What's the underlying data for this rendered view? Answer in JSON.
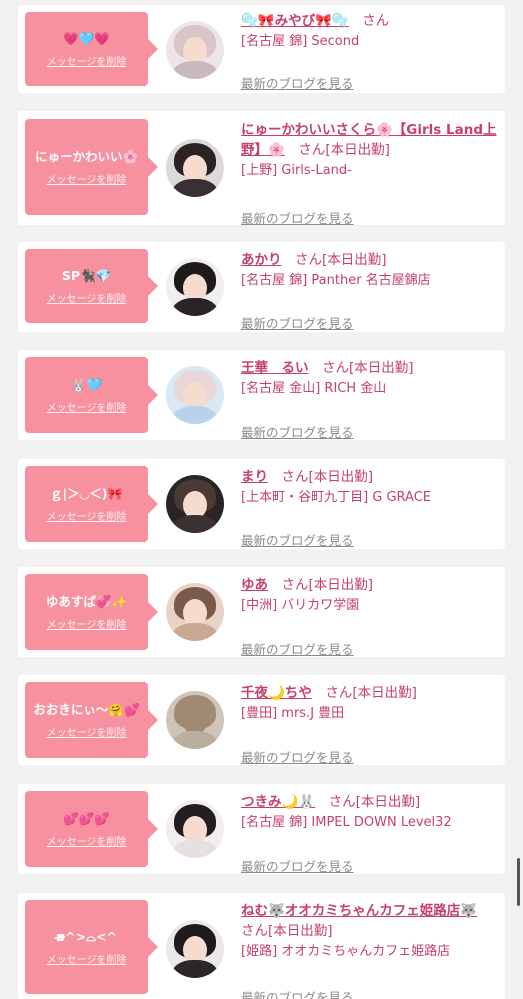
{
  "cards": [
    {
      "message": "💗🩵💗",
      "delete_label": "メッセージを削除",
      "name": "🫧🎀みやび🎀🫧",
      "san": "さん",
      "status": "",
      "shop": "[名古屋 錦] Second",
      "blog_label": "最新のブログを見る",
      "avatar_icon": "profile-photo"
    },
    {
      "message": "にゅーかわいい🌸",
      "delete_label": "メッセージを削除",
      "name": "にゅーかわいいさくら🌸【Girls Land上野】🌸",
      "san": "さん",
      "status": "[本日出勤]",
      "shop": "[上野] Girls-Land-",
      "blog_label": "最新のブログを見る",
      "avatar_icon": "profile-photo"
    },
    {
      "message": "SP🐈‍⬛💎",
      "delete_label": "メッセージを削除",
      "name": "あかり",
      "san": "さん",
      "status": "[本日出勤]",
      "shop": "[名古屋 錦] Panther 名古屋錦店",
      "blog_label": "最新のブログを見る",
      "avatar_icon": "profile-photo"
    },
    {
      "message": "🐰🩵",
      "delete_label": "メッセージを削除",
      "name": "王華　るい",
      "san": "さん",
      "status": "[本日出勤]",
      "shop": "[名古屋 金山] RICH 金山",
      "blog_label": "最新のブログを見る",
      "avatar_icon": "profile-photo"
    },
    {
      "message": "ｇ|＞◡＜)🎀",
      "delete_label": "メッセージを削除",
      "name": "まり",
      "san": "さん",
      "status": "[本日出勤]",
      "shop": "[上本町・谷町九丁目] G GRACE",
      "blog_label": "最新のブログを見る",
      "avatar_icon": "profile-photo"
    },
    {
      "message": "ゆあすぱ💞✨",
      "delete_label": "メッセージを削除",
      "name": "ゆあ",
      "san": "さん",
      "status": "[本日出勤]",
      "shop": "[中洲] バリカワ学園",
      "blog_label": "最新のブログを見る",
      "avatar_icon": "profile-photo"
    },
    {
      "message": "おおきにぃ〜🤗💕",
      "delete_label": "メッセージを削除",
      "name": "千夜🌙ちや",
      "san": "さん",
      "status": "[本日出勤]",
      "shop": "[豊田] mrs.J 豊田",
      "blog_label": "最新のブログを見る",
      "avatar_icon": "profile-photo"
    },
    {
      "message": "💕💕💕",
      "delete_label": "メッセージを削除",
      "name": "つきみ🌙🐰",
      "san": "さん",
      "status": "[本日出勤]",
      "shop": "[名古屋 錦] IMPEL DOWN Level32",
      "blog_label": "最新のブログを見る",
      "avatar_icon": "profile-photo"
    },
    {
      "message": "ʚ̴̶̷^>⌓<^",
      "delete_label": "メッセージを削除",
      "name": "ねむ🐺オオカミちゃんカフェ姫路店🐺",
      "san": "さん",
      "status": "[本日出勤]",
      "shop": "[姫路] オオカミちゃんカフェ姫路店",
      "blog_label": "最新のブログを見る",
      "avatar_icon": "profile-photo"
    }
  ],
  "colors": {
    "accent": "#f7919f",
    "name_text": "#c8406a",
    "link_gray": "#8a8a8a"
  }
}
